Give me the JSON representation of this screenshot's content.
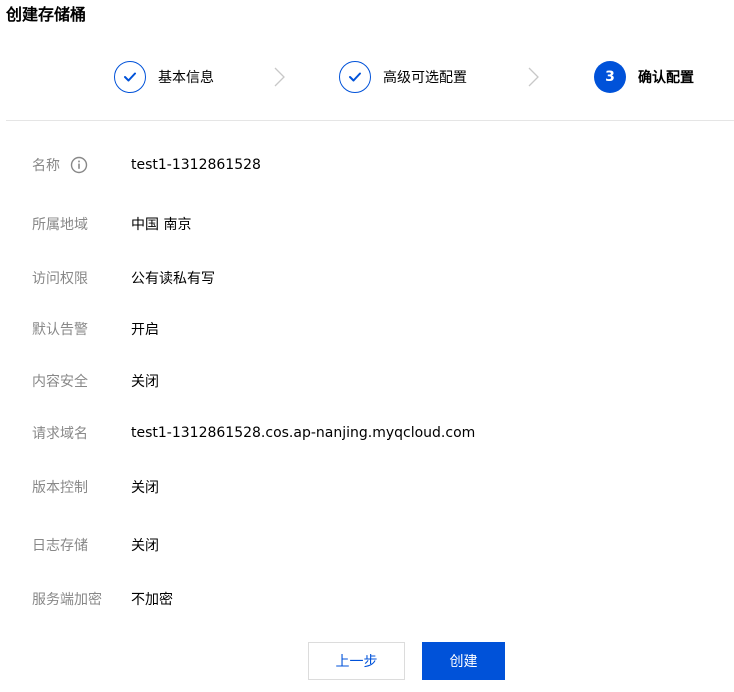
{
  "page": {
    "title": "创建存储桶"
  },
  "steps": [
    {
      "label": "基本信息",
      "status": "done",
      "icon": "check-icon"
    },
    {
      "label": "高级可选配置",
      "status": "done",
      "icon": "check-icon"
    },
    {
      "number": "3",
      "label": "确认配置",
      "status": "active"
    }
  ],
  "colors": {
    "accent": "#0052d9",
    "label": "#888888",
    "divider": "#e5e5e5"
  },
  "fields": [
    {
      "label": "名称",
      "value": "test1-1312861528",
      "icon": "info-icon"
    },
    {
      "label": "所属地域",
      "value": "中国 南京"
    },
    {
      "label": "访问权限",
      "value": "公有读私有写"
    },
    {
      "label": "默认告警",
      "value": "开启"
    },
    {
      "label": "内容安全",
      "value": "关闭"
    },
    {
      "label": "请求域名",
      "value": "test1-1312861528.cos.ap-nanjing.myqcloud.com"
    },
    {
      "label": "版本控制",
      "value": "关闭"
    },
    {
      "label": "日志存储",
      "value": "关闭"
    },
    {
      "label": "服务端加密",
      "value": "不加密"
    }
  ],
  "actions": {
    "prev_label": "上一步",
    "create_label": "创建"
  }
}
